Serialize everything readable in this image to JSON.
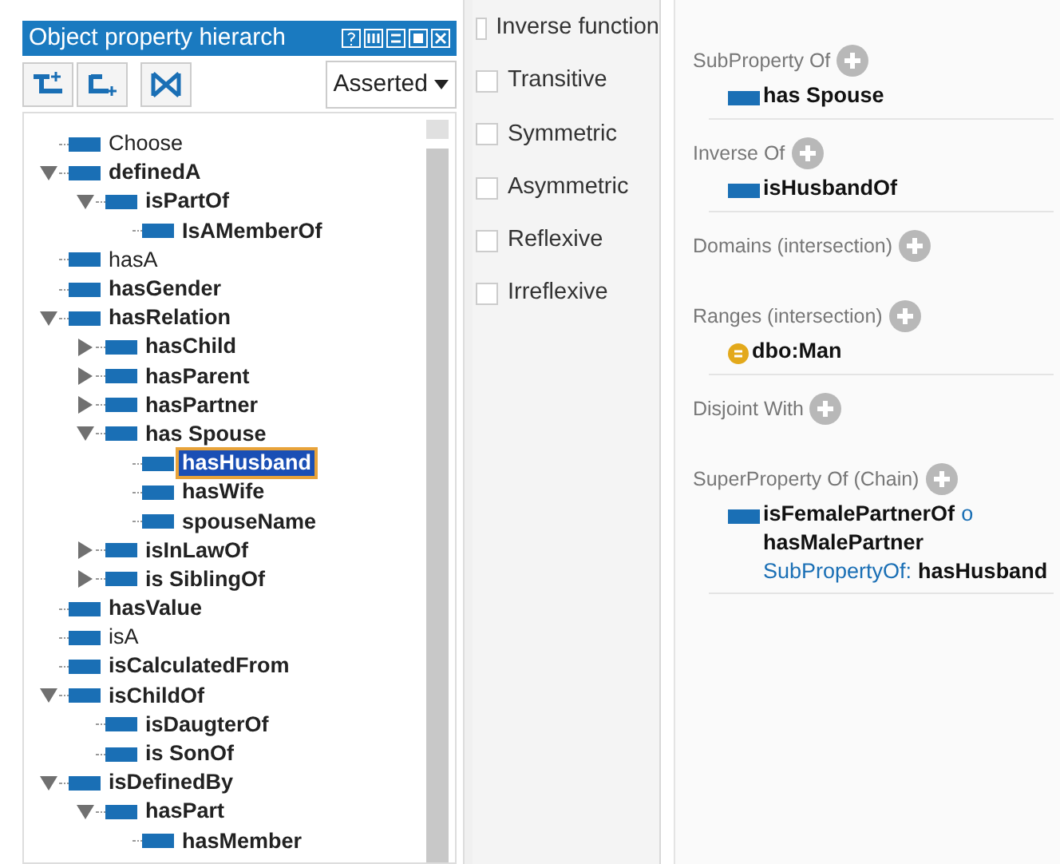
{
  "panel": {
    "title": "Object property hierarch",
    "view_mode": "Asserted"
  },
  "tree": [
    {
      "label": "Choose",
      "bold": false,
      "kind": "leaf",
      "selected": false
    },
    {
      "label": "definedA",
      "bold": true,
      "kind": "branch",
      "expanded": true,
      "selected": false,
      "children": [
        {
          "label": "isPartOf",
          "bold": true,
          "kind": "branch",
          "expanded": true,
          "selected": false,
          "children": [
            {
              "label": "IsAMemberOf",
              "bold": true,
              "kind": "leaf",
              "selected": false
            }
          ]
        }
      ]
    },
    {
      "label": "hasA",
      "bold": false,
      "kind": "leaf",
      "selected": false
    },
    {
      "label": "hasGender",
      "bold": true,
      "kind": "leaf",
      "selected": false
    },
    {
      "label": "hasRelation",
      "bold": true,
      "kind": "branch",
      "expanded": true,
      "selected": false,
      "children": [
        {
          "label": "hasChild",
          "bold": true,
          "kind": "branch",
          "expanded": false,
          "selected": false
        },
        {
          "label": "hasParent",
          "bold": true,
          "kind": "branch",
          "expanded": false,
          "selected": false
        },
        {
          "label": "hasPartner",
          "bold": true,
          "kind": "branch",
          "expanded": false,
          "selected": false
        },
        {
          "label": "has Spouse",
          "bold": true,
          "kind": "branch",
          "expanded": true,
          "selected": false,
          "children": [
            {
              "label": "hasHusband",
              "bold": true,
              "kind": "leaf",
              "selected": true
            },
            {
              "label": "hasWife",
              "bold": true,
              "kind": "leaf",
              "selected": false
            },
            {
              "label": "spouseName",
              "bold": true,
              "kind": "leaf",
              "selected": false
            }
          ]
        },
        {
          "label": "isInLawOf",
          "bold": true,
          "kind": "branch",
          "expanded": false,
          "selected": false
        },
        {
          "label": "is SiblingOf",
          "bold": true,
          "kind": "branch",
          "expanded": false,
          "selected": false
        }
      ]
    },
    {
      "label": "hasValue",
      "bold": true,
      "kind": "leaf",
      "selected": false
    },
    {
      "label": "isA",
      "bold": false,
      "kind": "leaf",
      "selected": false
    },
    {
      "label": "isCalculatedFrom",
      "bold": true,
      "kind": "leaf",
      "selected": false
    },
    {
      "label": "isChildOf",
      "bold": true,
      "kind": "branch",
      "expanded": true,
      "selected": false,
      "children": [
        {
          "label": "isDaugterOf",
          "bold": true,
          "kind": "leaf",
          "selected": false
        },
        {
          "label": "is SonOf",
          "bold": true,
          "kind": "leaf",
          "selected": false
        }
      ]
    },
    {
      "label": "isDefinedBy",
      "bold": true,
      "kind": "branch",
      "expanded": true,
      "selected": false,
      "children": [
        {
          "label": "hasPart",
          "bold": true,
          "kind": "branch",
          "expanded": true,
          "selected": false,
          "children": [
            {
              "label": "hasMember",
              "bold": true,
              "kind": "leaf",
              "selected": false
            }
          ]
        }
      ]
    }
  ],
  "characteristics": [
    {
      "label": "Inverse function",
      "checked": false
    },
    {
      "label": "Transitive",
      "checked": false
    },
    {
      "label": "Symmetric",
      "checked": false
    },
    {
      "label": "Asymmetric",
      "checked": false
    },
    {
      "label": "Reflexive",
      "checked": false
    },
    {
      "label": "Irreflexive",
      "checked": false
    }
  ],
  "description": [
    {
      "label": "SubProperty Of",
      "entries": [
        {
          "kind": "property",
          "lines": [
            [
              {
                "text": "has Spouse",
                "kind": "name"
              }
            ]
          ]
        }
      ]
    },
    {
      "label": "Inverse Of",
      "entries": [
        {
          "kind": "property",
          "lines": [
            [
              {
                "text": "isHusbandOf",
                "kind": "name"
              }
            ]
          ]
        }
      ]
    },
    {
      "label": "Domains (intersection)"
    },
    {
      "label": "Ranges (intersection)",
      "entries": [
        {
          "kind": "class",
          "lines": [
            [
              {
                "text": "dbo:Man",
                "kind": "name"
              }
            ]
          ]
        }
      ]
    },
    {
      "label": "Disjoint With"
    },
    {
      "label": "SuperProperty Of (Chain)",
      "entries": [
        {
          "kind": "property",
          "lines": [
            [
              {
                "text": "isFemalePartnerOf",
                "kind": "name"
              },
              {
                "text": "o",
                "kind": "keyword"
              }
            ],
            [
              {
                "text": "hasMalePartner",
                "kind": "name"
              }
            ],
            [
              {
                "text": "SubPropertyOf:",
                "kind": "keyword"
              },
              {
                "text": "hasHusband",
                "kind": "name"
              }
            ]
          ]
        }
      ]
    }
  ]
}
